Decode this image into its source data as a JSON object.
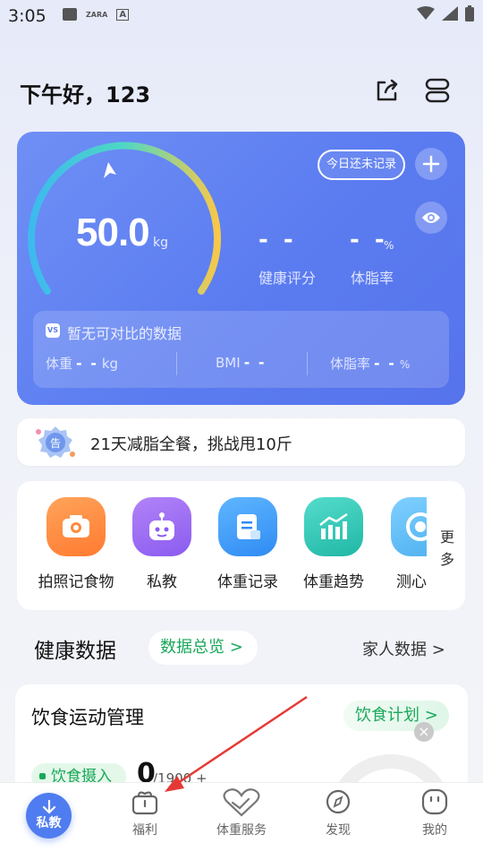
{
  "status_bar": {
    "time": "3:05",
    "notif_text_1": "ZARA",
    "notif_text_2": "A"
  },
  "header": {
    "greeting": "下午好，123",
    "share_icon": "share-icon",
    "device_icon": "device-list-icon"
  },
  "weight_card": {
    "weight_value": "50.0",
    "weight_unit": "kg",
    "today_record_label": "今日还未记录",
    "health_score_value": "- -",
    "health_score_label": "健康评分",
    "body_fat_value": "- -",
    "body_fat_unit": "%",
    "body_fat_label": "体脂率",
    "compare": {
      "badge": "VS",
      "title": "暂无可对比的数据",
      "items": [
        {
          "label": "体重",
          "value": "- -",
          "unit": "kg"
        },
        {
          "label": "BMI",
          "value": "- -",
          "unit": ""
        },
        {
          "label": "体脂率",
          "value": "- -",
          "unit": "%"
        }
      ]
    },
    "colors": {
      "card": "#5b7cf0",
      "gauge_start": "#3fc8e4",
      "gauge_end": "#f6c94c"
    }
  },
  "promo": {
    "badge": "告",
    "text": "21天减脂全餐，挑战甩10斤"
  },
  "features": {
    "items": [
      {
        "label": "拍照记食物",
        "icon": "camera-icon",
        "color": "#ff8a3d"
      },
      {
        "label": "私教",
        "icon": "robot-icon",
        "color": "#9b6cf0"
      },
      {
        "label": "体重记录",
        "icon": "note-icon",
        "color": "#3d9cf5"
      },
      {
        "label": "体重趋势",
        "icon": "chart-icon",
        "color": "#2fc6b5"
      },
      {
        "label": "测心",
        "icon": "measure-icon",
        "color": "#5ab8f0"
      }
    ],
    "more_label": "更多"
  },
  "health_data": {
    "title": "健康数据",
    "overview_label": "数据总览 >",
    "family_label": "家人数据 >"
  },
  "diet_card": {
    "title": "饮食运动管理",
    "plan_label": "饮食计划 >",
    "intake_label": "饮食摄入",
    "intake_value": "0",
    "intake_rest": "/1900 +"
  },
  "bottom_nav": {
    "center_label": "私教",
    "items": [
      {
        "label": "福利",
        "icon": "gift-icon"
      },
      {
        "label": "体重服务",
        "icon": "heart-icon"
      },
      {
        "label": "发现",
        "icon": "compass-icon"
      },
      {
        "label": "我的",
        "icon": "profile-icon"
      }
    ]
  },
  "annotation": {
    "arrow_color": "#e53935"
  }
}
